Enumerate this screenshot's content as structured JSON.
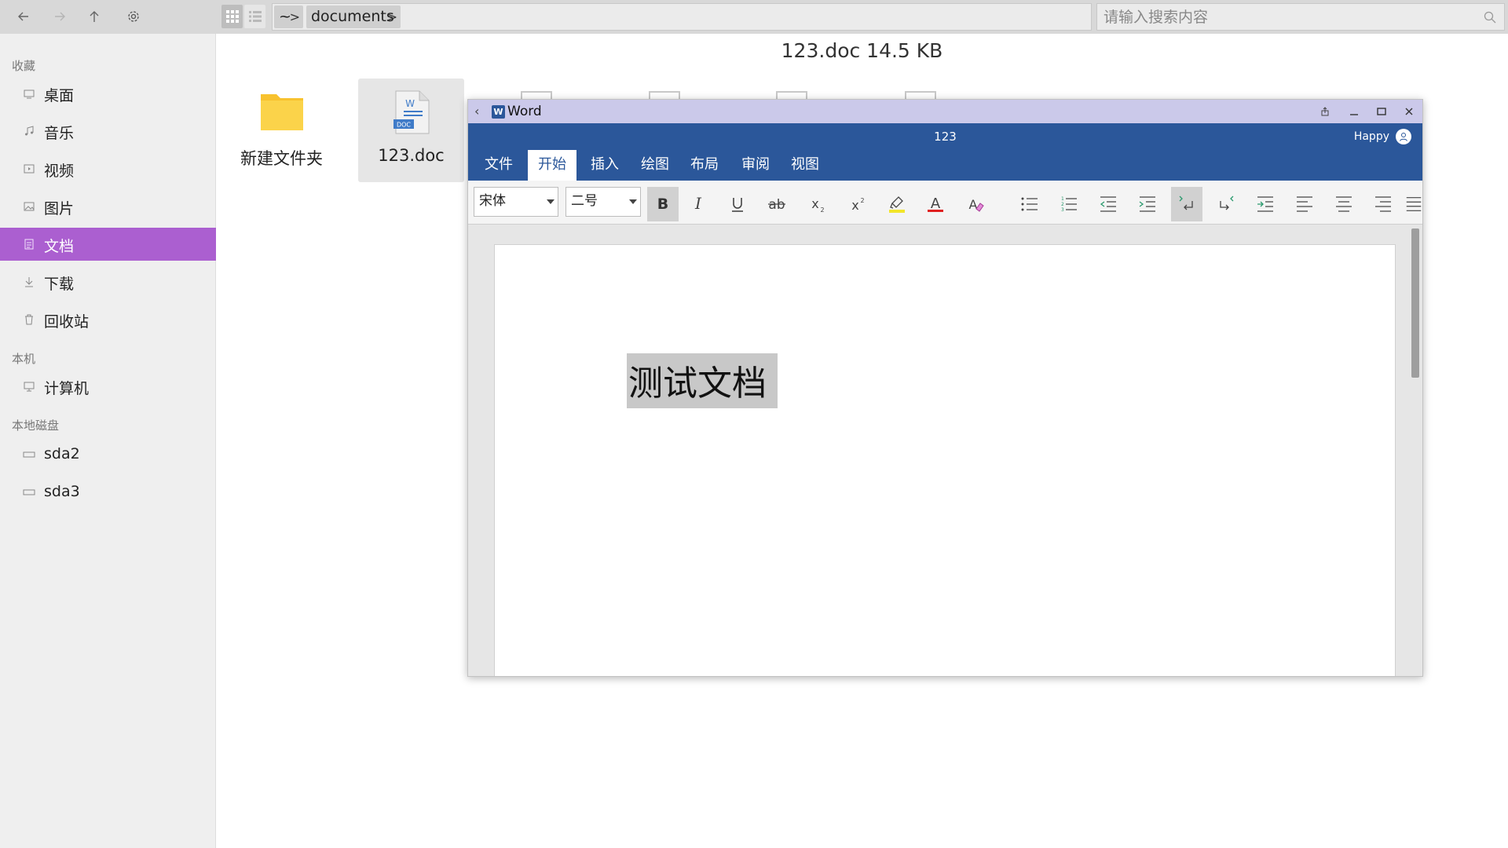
{
  "search": {
    "placeholder": "请输入搜索内容"
  },
  "breadcrumb": {
    "home": "~",
    "folder": "documents"
  },
  "sidebar": {
    "favorites_heading": "收藏",
    "favorites": [
      {
        "label": "桌面",
        "icon": "desktop-icon"
      },
      {
        "label": "音乐",
        "icon": "music-icon"
      },
      {
        "label": "视频",
        "icon": "video-icon"
      },
      {
        "label": "图片",
        "icon": "picture-icon"
      },
      {
        "label": "文档",
        "icon": "document-icon",
        "active": true
      },
      {
        "label": "下载",
        "icon": "download-icon"
      },
      {
        "label": "回收站",
        "icon": "trash-icon"
      }
    ],
    "computer_heading": "本机",
    "computer": [
      {
        "label": "计算机",
        "icon": "computer-icon"
      }
    ],
    "disks_heading": "本地磁盘",
    "disks": [
      {
        "label": "sda2",
        "icon": "disk-icon"
      },
      {
        "label": "sda3",
        "icon": "disk-icon"
      }
    ]
  },
  "main": {
    "title": "123.doc 14.5 KB",
    "files": [
      {
        "name": "新建文件夹",
        "icon": "folder-icon"
      },
      {
        "name": "123.doc",
        "icon": "word-document-icon",
        "selected": true
      }
    ]
  },
  "word": {
    "app_name": "Word",
    "logo_letter": "W",
    "doc_title": "123",
    "user": "Happy",
    "tabs": [
      {
        "label": "文件"
      },
      {
        "label": "开始",
        "active": true
      },
      {
        "label": "插入"
      },
      {
        "label": "绘图"
      },
      {
        "label": "布局"
      },
      {
        "label": "审阅"
      },
      {
        "label": "视图"
      }
    ],
    "font": "宋体",
    "size": "二号",
    "body_text": "测试文档",
    "colors": {
      "ribbon": "#2b579a",
      "titlebar": "#cbc9ea",
      "font_color": "#e02020",
      "highlight": "#f2e52a"
    }
  },
  "colors": {
    "sidebar_active": "#ab5fd0",
    "folder": "#f8c22e"
  }
}
